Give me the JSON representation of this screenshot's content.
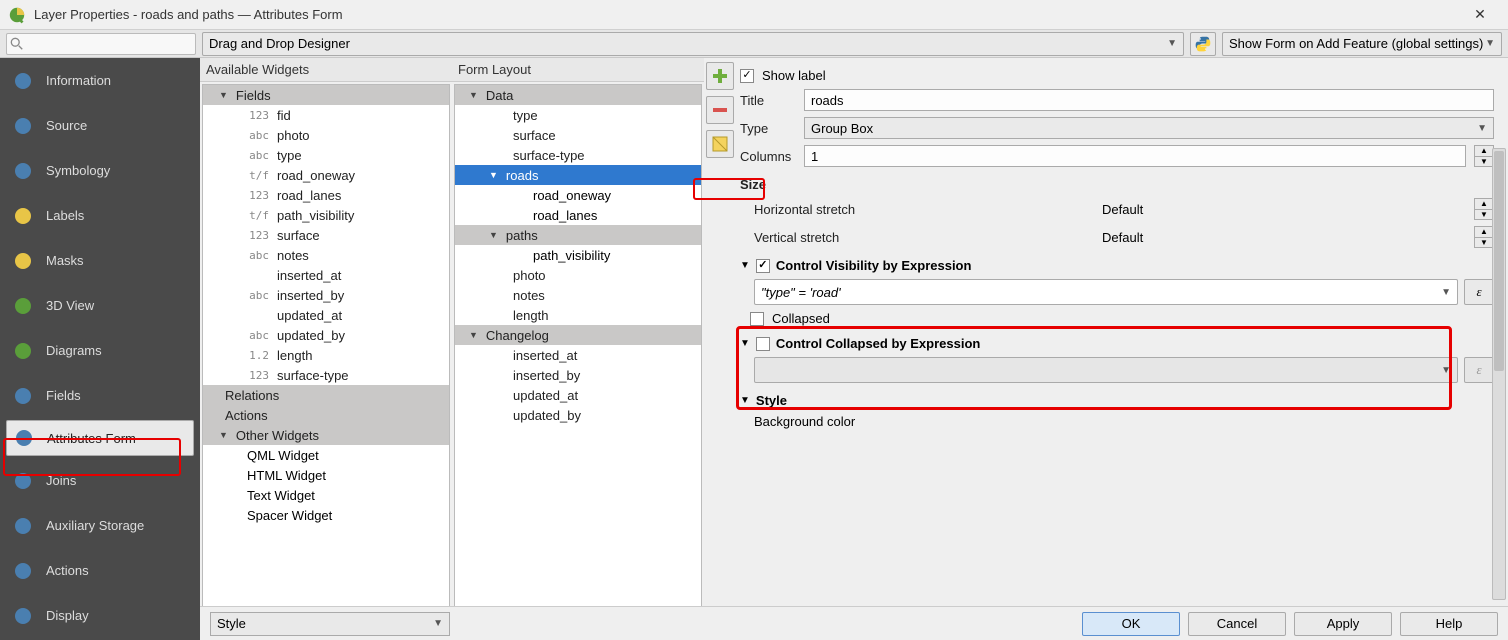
{
  "window": {
    "title": "Layer Properties - roads and paths — Attributes Form"
  },
  "top": {
    "designer": "Drag and Drop Designer",
    "show_form": "Show Form on Add Feature (global settings)"
  },
  "sidebar": {
    "items": [
      {
        "label": "Information"
      },
      {
        "label": "Source"
      },
      {
        "label": "Symbology"
      },
      {
        "label": "Labels"
      },
      {
        "label": "Masks"
      },
      {
        "label": "3D View"
      },
      {
        "label": "Diagrams"
      },
      {
        "label": "Fields"
      },
      {
        "label": "Attributes Form"
      },
      {
        "label": "Joins"
      },
      {
        "label": "Auxiliary Storage"
      },
      {
        "label": "Actions"
      },
      {
        "label": "Display"
      }
    ],
    "active_index": 8
  },
  "available": {
    "header": "Available Widgets",
    "fields_group": "Fields",
    "fields": [
      {
        "t": "123",
        "n": "fid"
      },
      {
        "t": "abc",
        "n": "photo"
      },
      {
        "t": "abc",
        "n": "type"
      },
      {
        "t": "t/f",
        "n": "road_oneway"
      },
      {
        "t": "123",
        "n": "road_lanes"
      },
      {
        "t": "t/f",
        "n": "path_visibility"
      },
      {
        "t": "123",
        "n": "surface"
      },
      {
        "t": "abc",
        "n": "notes"
      },
      {
        "t": "",
        "n": "inserted_at"
      },
      {
        "t": "abc",
        "n": "inserted_by"
      },
      {
        "t": "",
        "n": "updated_at"
      },
      {
        "t": "abc",
        "n": "updated_by"
      },
      {
        "t": "1.2",
        "n": "length"
      },
      {
        "t": "123",
        "n": "surface-type"
      }
    ],
    "relations": "Relations",
    "actions": "Actions",
    "other": "Other Widgets",
    "others": [
      "QML Widget",
      "HTML Widget",
      "Text Widget",
      "Spacer Widget"
    ]
  },
  "layout": {
    "header": "Form Layout",
    "data": "Data",
    "data_items": [
      "type",
      "surface",
      "surface-type"
    ],
    "roads": "roads",
    "roads_items": [
      "road_oneway",
      "road_lanes"
    ],
    "paths": "paths",
    "paths_items": [
      "path_visibility"
    ],
    "loose": [
      "photo",
      "notes",
      "length"
    ],
    "changelog": "Changelog",
    "changelog_items": [
      "inserted_at",
      "inserted_by",
      "updated_at",
      "updated_by"
    ]
  },
  "props": {
    "show_label": "Show label",
    "title_lbl": "Title",
    "title_val": "roads",
    "type_lbl": "Type",
    "type_val": "Group Box",
    "cols_lbl": "Columns",
    "cols_val": "1",
    "size": "Size",
    "hstretch": "Horizontal stretch",
    "hval": "Default",
    "vstretch": "Vertical stretch",
    "vval": "Default",
    "vis_expr_title": "Control Visibility by Expression",
    "expr_val": "\"type\"  =  'road'",
    "collapsed": "Collapsed",
    "col_expr_title": "Control Collapsed by Expression",
    "style": "Style",
    "bgcolor": "Background color"
  },
  "buttons": {
    "style": "Style",
    "ok": "OK",
    "cancel": "Cancel",
    "apply": "Apply",
    "help": "Help"
  }
}
